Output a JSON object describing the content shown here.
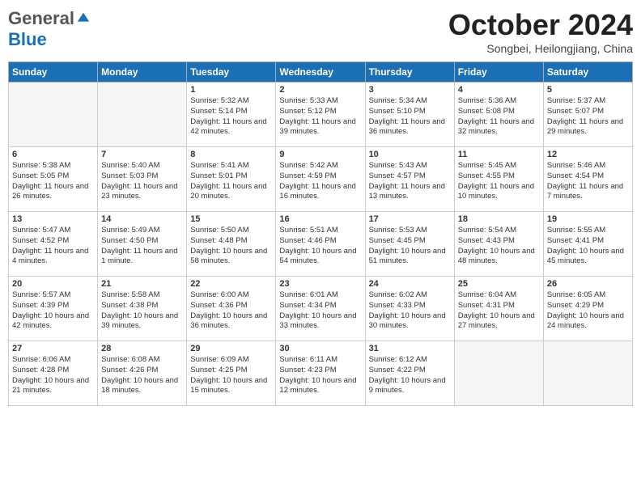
{
  "header": {
    "logo": {
      "general": "General",
      "blue": "Blue"
    },
    "title": "October 2024",
    "location": "Songbei, Heilongjiang, China"
  },
  "weekdays": [
    "Sunday",
    "Monday",
    "Tuesday",
    "Wednesday",
    "Thursday",
    "Friday",
    "Saturday"
  ],
  "weeks": [
    [
      {
        "day": "",
        "empty": true
      },
      {
        "day": "",
        "empty": true
      },
      {
        "day": "1",
        "sunrise": "Sunrise: 5:32 AM",
        "sunset": "Sunset: 5:14 PM",
        "daylight": "Daylight: 11 hours and 42 minutes."
      },
      {
        "day": "2",
        "sunrise": "Sunrise: 5:33 AM",
        "sunset": "Sunset: 5:12 PM",
        "daylight": "Daylight: 11 hours and 39 minutes."
      },
      {
        "day": "3",
        "sunrise": "Sunrise: 5:34 AM",
        "sunset": "Sunset: 5:10 PM",
        "daylight": "Daylight: 11 hours and 36 minutes."
      },
      {
        "day": "4",
        "sunrise": "Sunrise: 5:36 AM",
        "sunset": "Sunset: 5:08 PM",
        "daylight": "Daylight: 11 hours and 32 minutes."
      },
      {
        "day": "5",
        "sunrise": "Sunrise: 5:37 AM",
        "sunset": "Sunset: 5:07 PM",
        "daylight": "Daylight: 11 hours and 29 minutes."
      }
    ],
    [
      {
        "day": "6",
        "sunrise": "Sunrise: 5:38 AM",
        "sunset": "Sunset: 5:05 PM",
        "daylight": "Daylight: 11 hours and 26 minutes."
      },
      {
        "day": "7",
        "sunrise": "Sunrise: 5:40 AM",
        "sunset": "Sunset: 5:03 PM",
        "daylight": "Daylight: 11 hours and 23 minutes."
      },
      {
        "day": "8",
        "sunrise": "Sunrise: 5:41 AM",
        "sunset": "Sunset: 5:01 PM",
        "daylight": "Daylight: 11 hours and 20 minutes."
      },
      {
        "day": "9",
        "sunrise": "Sunrise: 5:42 AM",
        "sunset": "Sunset: 4:59 PM",
        "daylight": "Daylight: 11 hours and 16 minutes."
      },
      {
        "day": "10",
        "sunrise": "Sunrise: 5:43 AM",
        "sunset": "Sunset: 4:57 PM",
        "daylight": "Daylight: 11 hours and 13 minutes."
      },
      {
        "day": "11",
        "sunrise": "Sunrise: 5:45 AM",
        "sunset": "Sunset: 4:55 PM",
        "daylight": "Daylight: 11 hours and 10 minutes."
      },
      {
        "day": "12",
        "sunrise": "Sunrise: 5:46 AM",
        "sunset": "Sunset: 4:54 PM",
        "daylight": "Daylight: 11 hours and 7 minutes."
      }
    ],
    [
      {
        "day": "13",
        "sunrise": "Sunrise: 5:47 AM",
        "sunset": "Sunset: 4:52 PM",
        "daylight": "Daylight: 11 hours and 4 minutes."
      },
      {
        "day": "14",
        "sunrise": "Sunrise: 5:49 AM",
        "sunset": "Sunset: 4:50 PM",
        "daylight": "Daylight: 11 hours and 1 minute."
      },
      {
        "day": "15",
        "sunrise": "Sunrise: 5:50 AM",
        "sunset": "Sunset: 4:48 PM",
        "daylight": "Daylight: 10 hours and 58 minutes."
      },
      {
        "day": "16",
        "sunrise": "Sunrise: 5:51 AM",
        "sunset": "Sunset: 4:46 PM",
        "daylight": "Daylight: 10 hours and 54 minutes."
      },
      {
        "day": "17",
        "sunrise": "Sunrise: 5:53 AM",
        "sunset": "Sunset: 4:45 PM",
        "daylight": "Daylight: 10 hours and 51 minutes."
      },
      {
        "day": "18",
        "sunrise": "Sunrise: 5:54 AM",
        "sunset": "Sunset: 4:43 PM",
        "daylight": "Daylight: 10 hours and 48 minutes."
      },
      {
        "day": "19",
        "sunrise": "Sunrise: 5:55 AM",
        "sunset": "Sunset: 4:41 PM",
        "daylight": "Daylight: 10 hours and 45 minutes."
      }
    ],
    [
      {
        "day": "20",
        "sunrise": "Sunrise: 5:57 AM",
        "sunset": "Sunset: 4:39 PM",
        "daylight": "Daylight: 10 hours and 42 minutes."
      },
      {
        "day": "21",
        "sunrise": "Sunrise: 5:58 AM",
        "sunset": "Sunset: 4:38 PM",
        "daylight": "Daylight: 10 hours and 39 minutes."
      },
      {
        "day": "22",
        "sunrise": "Sunrise: 6:00 AM",
        "sunset": "Sunset: 4:36 PM",
        "daylight": "Daylight: 10 hours and 36 minutes."
      },
      {
        "day": "23",
        "sunrise": "Sunrise: 6:01 AM",
        "sunset": "Sunset: 4:34 PM",
        "daylight": "Daylight: 10 hours and 33 minutes."
      },
      {
        "day": "24",
        "sunrise": "Sunrise: 6:02 AM",
        "sunset": "Sunset: 4:33 PM",
        "daylight": "Daylight: 10 hours and 30 minutes."
      },
      {
        "day": "25",
        "sunrise": "Sunrise: 6:04 AM",
        "sunset": "Sunset: 4:31 PM",
        "daylight": "Daylight: 10 hours and 27 minutes."
      },
      {
        "day": "26",
        "sunrise": "Sunrise: 6:05 AM",
        "sunset": "Sunset: 4:29 PM",
        "daylight": "Daylight: 10 hours and 24 minutes."
      }
    ],
    [
      {
        "day": "27",
        "sunrise": "Sunrise: 6:06 AM",
        "sunset": "Sunset: 4:28 PM",
        "daylight": "Daylight: 10 hours and 21 minutes."
      },
      {
        "day": "28",
        "sunrise": "Sunrise: 6:08 AM",
        "sunset": "Sunset: 4:26 PM",
        "daylight": "Daylight: 10 hours and 18 minutes."
      },
      {
        "day": "29",
        "sunrise": "Sunrise: 6:09 AM",
        "sunset": "Sunset: 4:25 PM",
        "daylight": "Daylight: 10 hours and 15 minutes."
      },
      {
        "day": "30",
        "sunrise": "Sunrise: 6:11 AM",
        "sunset": "Sunset: 4:23 PM",
        "daylight": "Daylight: 10 hours and 12 minutes."
      },
      {
        "day": "31",
        "sunrise": "Sunrise: 6:12 AM",
        "sunset": "Sunset: 4:22 PM",
        "daylight": "Daylight: 10 hours and 9 minutes."
      },
      {
        "day": "",
        "empty": true
      },
      {
        "day": "",
        "empty": true
      }
    ]
  ]
}
